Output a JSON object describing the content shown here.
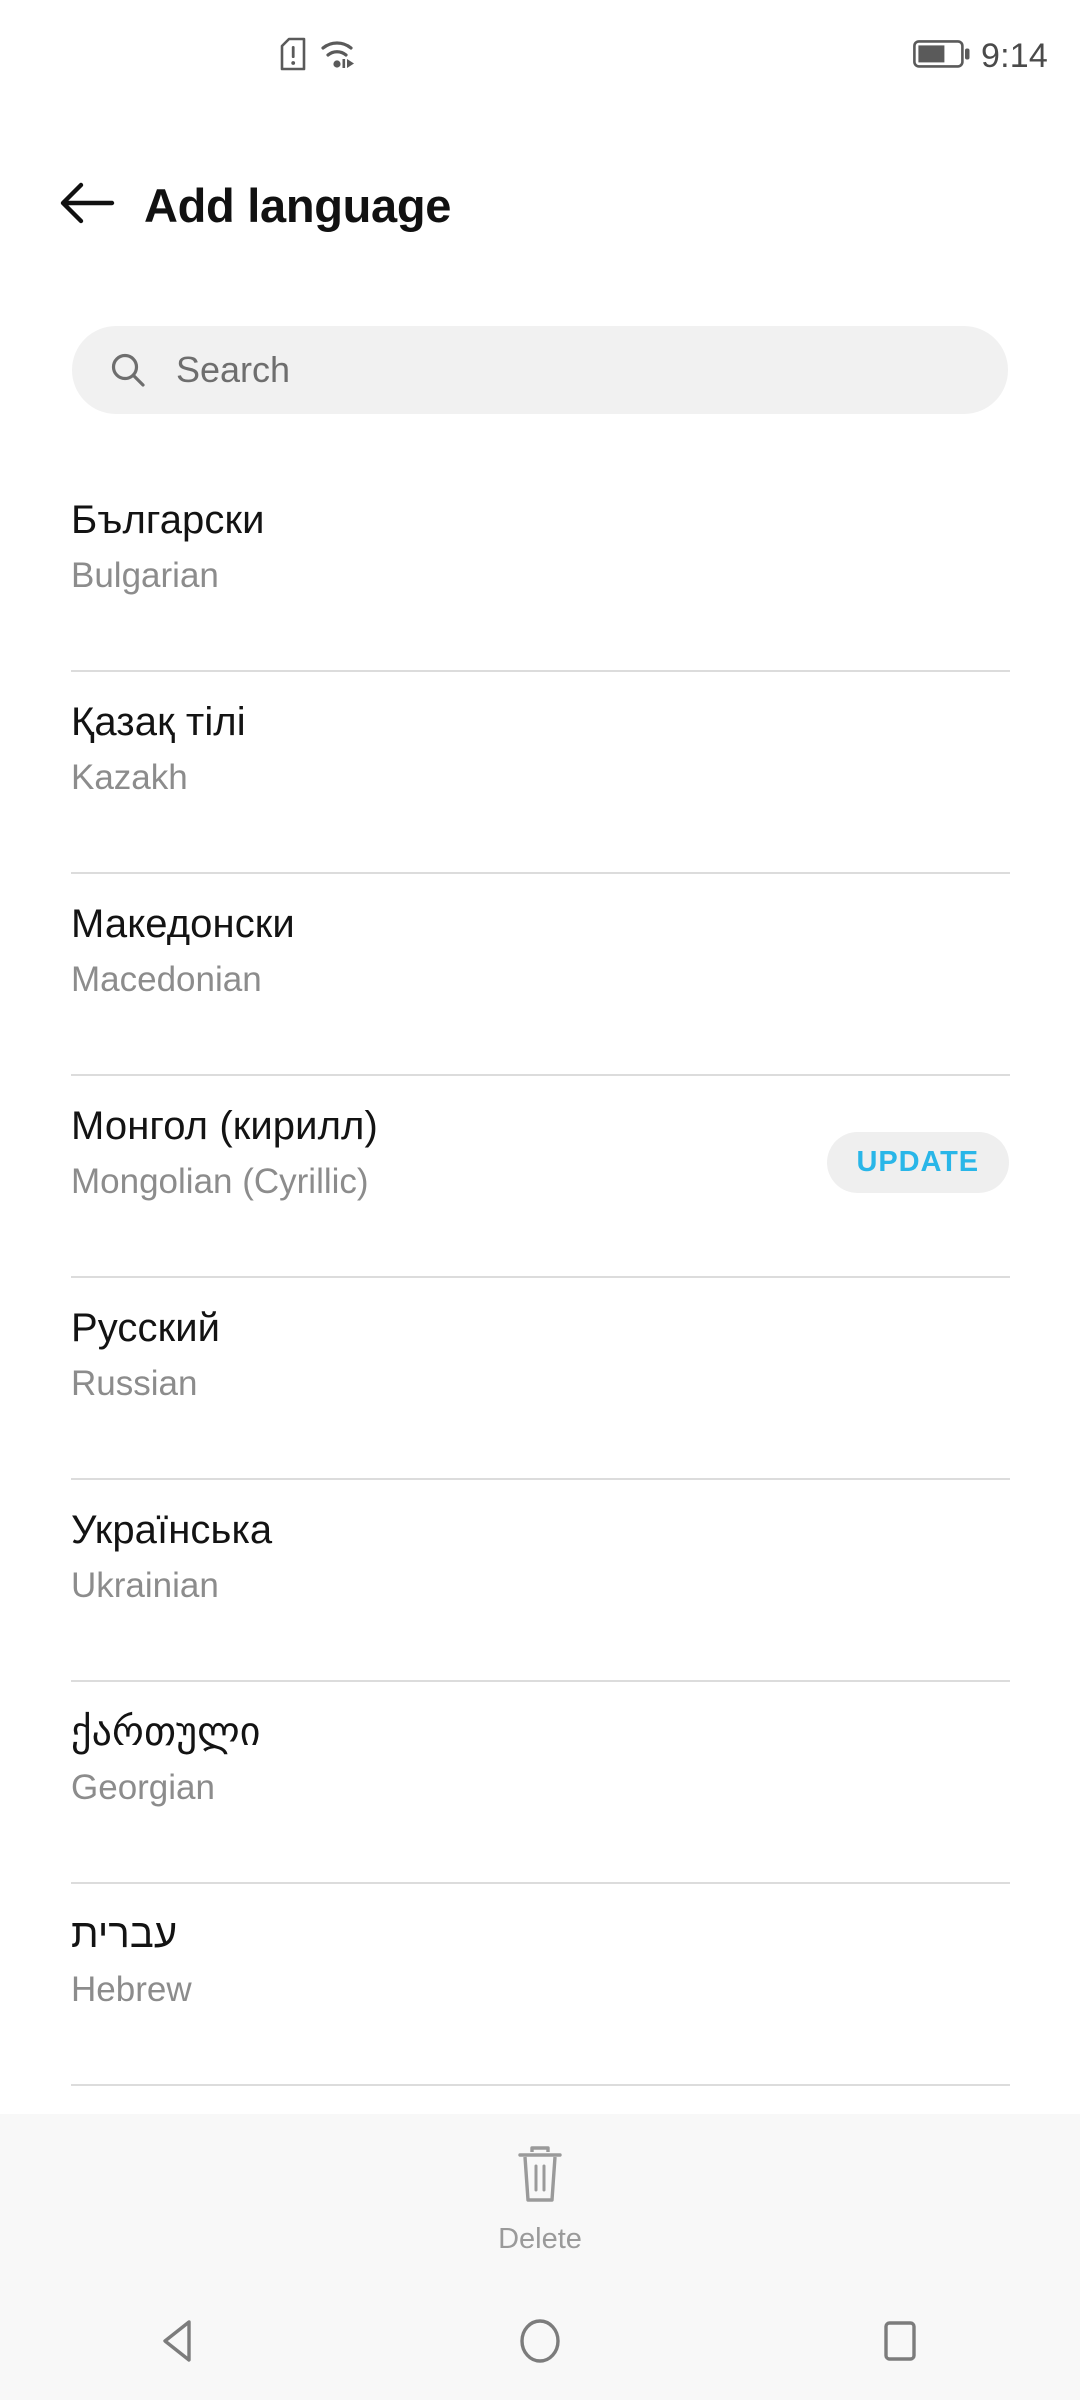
{
  "status_bar": {
    "time": "9:14",
    "icons": [
      "sim-card-alert-icon",
      "wifi-icon",
      "battery-icon"
    ],
    "battery_level_percent": 60
  },
  "header": {
    "back_icon": "arrow-left-icon",
    "title": "Add language"
  },
  "search": {
    "icon": "search-icon",
    "placeholder": "Search",
    "value": ""
  },
  "languages": [
    {
      "native": "Български",
      "english": "Bulgarian",
      "action": null
    },
    {
      "native": "Қазақ тілі",
      "english": "Kazakh",
      "action": null
    },
    {
      "native": "Македонски",
      "english": "Macedonian",
      "action": null
    },
    {
      "native": "Монгол (кирилл)",
      "english": "Mongolian (Cyrillic)",
      "action": "UPDATE"
    },
    {
      "native": "Русский",
      "english": "Russian",
      "action": null
    },
    {
      "native": "Українська",
      "english": "Ukrainian",
      "action": null
    },
    {
      "native": "ქართული",
      "english": "Georgian",
      "action": null
    },
    {
      "native": "עברית",
      "english": "Hebrew",
      "action": null
    }
  ],
  "bottom_bar": {
    "delete_icon": "trash-icon",
    "delete_label": "Delete"
  },
  "navigation_bar": {
    "back_icon": "nav-back-triangle-icon",
    "home_icon": "nav-home-circle-icon",
    "recents_icon": "nav-recents-square-icon"
  },
  "colors": {
    "accent": "#29b6e8",
    "background": "#ffffff",
    "search_field": "#f1f1f1",
    "bottom_bar": "#f8f8f8",
    "primary_text": "#131313",
    "secondary_text": "#8c8c8c",
    "divider": "#dcdcdc"
  }
}
